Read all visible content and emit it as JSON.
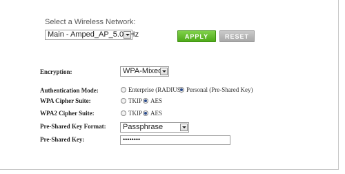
{
  "network": {
    "label": "Select a Wireless Network:",
    "selected": "Main - Amped_AP_5.0GHz"
  },
  "buttons": {
    "apply": "APPLY",
    "reset": "RESET"
  },
  "encryption": {
    "label": "Encryption:",
    "selected": "WPA-Mixed"
  },
  "auth_mode": {
    "label": "Authentication Mode:",
    "options": [
      "Enterprise (RADIUS)",
      "Personal (Pre-Shared Key)"
    ],
    "selected": "Personal (Pre-Shared Key)"
  },
  "wpa_cipher": {
    "label": "WPA Cipher Suite:",
    "options": [
      "TKIP",
      "AES"
    ],
    "selected": "AES"
  },
  "wpa2_cipher": {
    "label": "WPA2 Cipher Suite:",
    "options": [
      "TKIP",
      "AES"
    ],
    "selected": "AES"
  },
  "psk_format": {
    "label": "Pre-Shared Key Format:",
    "selected": "Passphrase"
  },
  "psk": {
    "label": "Pre-Shared Key:",
    "value": "••••••••"
  }
}
